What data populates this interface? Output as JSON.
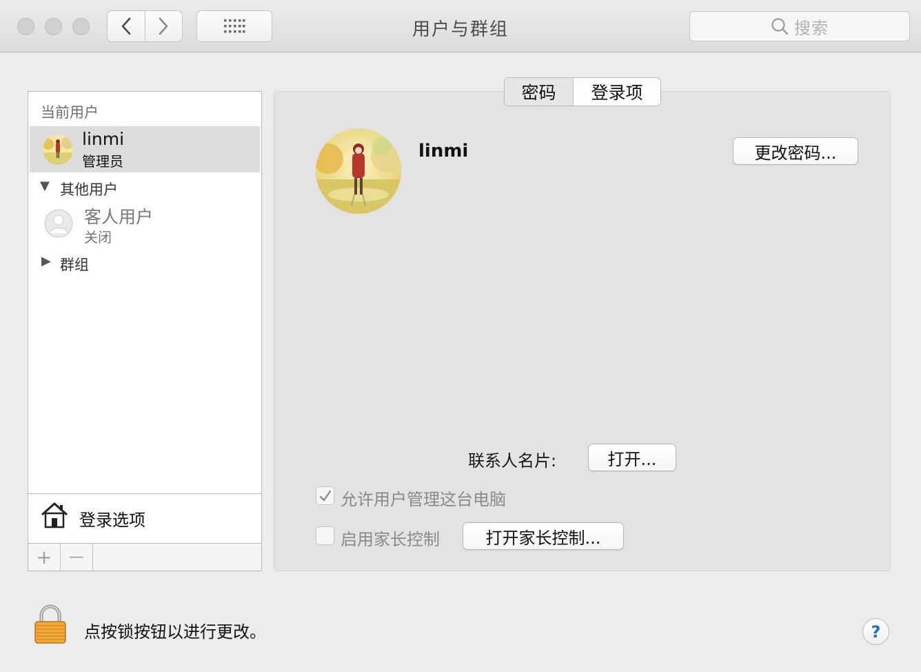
{
  "window": {
    "title": "用户与群组",
    "search_placeholder": "搜索"
  },
  "sidebar": {
    "current_users_header": "当前用户",
    "current_user": {
      "name": "linmi",
      "role": "管理员"
    },
    "other_users_header": "其他用户",
    "guest": {
      "name": "客人用户",
      "status": "关闭"
    },
    "groups_label": "群组",
    "login_options_label": "登录选项",
    "add_label": "+",
    "remove_label": "—"
  },
  "tabs": [
    {
      "label": "密码"
    },
    {
      "label": "登录项"
    }
  ],
  "detail": {
    "user_name": "linmi",
    "change_password_label": "更改密码...",
    "contact_card_label": "联系人名片:",
    "open_label": "打开...",
    "allow_admin_label": "允许用户管理这台电脑",
    "allow_admin_checked": true,
    "parental_label": "启用家长控制",
    "parental_checked": false,
    "open_parental_label": "打开家长控制..."
  },
  "footer": {
    "lock_text": "点按锁按钮以进行更改。",
    "help_label": "?"
  }
}
